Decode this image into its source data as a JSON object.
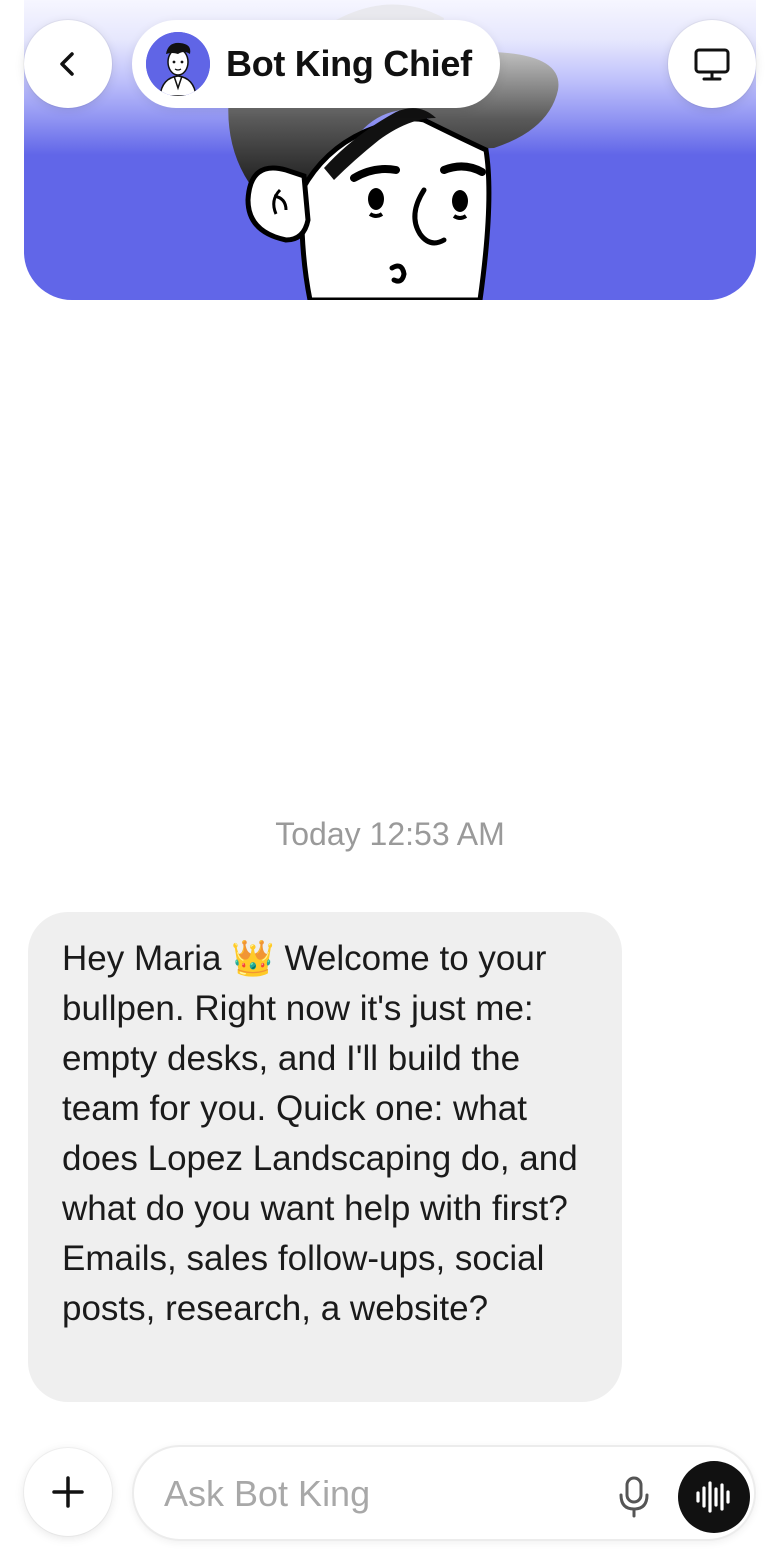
{
  "header": {
    "title": "Bot King Chief",
    "back_icon": "chevron-left-icon",
    "screen_icon": "monitor-icon"
  },
  "chat": {
    "timestamp": "Today 12:53 AM",
    "messages": [
      {
        "sender": "bot",
        "text": "Hey Maria 👑 Welcome to your bullpen. Right now it's just me: empty desks, and I'll build the team for you. Quick one: what does Lopez Landscaping do, and what do you want help with first? Emails, sales follow-ups, social posts, research, a website?"
      }
    ]
  },
  "composer": {
    "placeholder": "Ask Bot King",
    "value": "",
    "add_icon": "plus-icon",
    "mic_icon": "microphone-icon",
    "voice_icon": "voice-waveform-icon"
  },
  "colors": {
    "hero_accent": "#6166e8",
    "bubble_bg": "#efefef",
    "timestamp": "#9a9a9a",
    "voice_button": "#111111"
  }
}
